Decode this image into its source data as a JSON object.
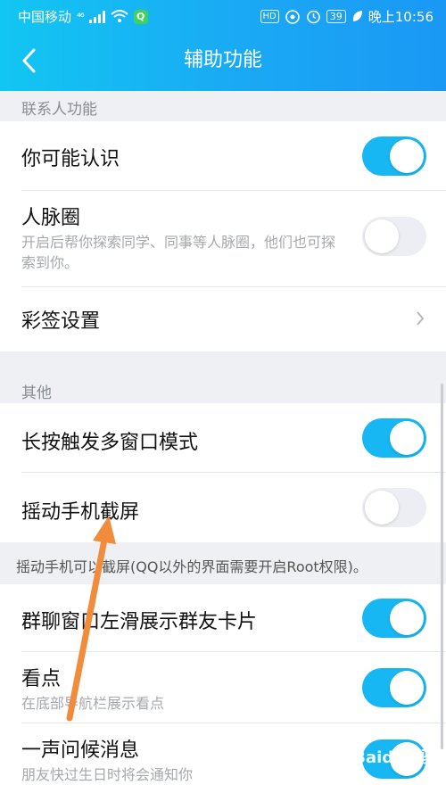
{
  "status_bar": {
    "carrier": "中国移动",
    "signal": "⁴⁶",
    "badge": "Q",
    "hd": "HD",
    "battery": "39",
    "time": "晚上10:56"
  },
  "header": {
    "title": "辅助功能"
  },
  "sections": {
    "contacts": {
      "label": "联系人功能",
      "items": [
        {
          "label": "你可能认识",
          "on": true
        },
        {
          "label": "人脉圈",
          "desc": "开启后帮你探索同学、同事等人脉圈，他们也可探索到你。",
          "on": false
        },
        {
          "label": "彩签设置"
        }
      ]
    },
    "other": {
      "label": "其他",
      "items": [
        {
          "label": "长按触发多窗口模式",
          "on": true
        },
        {
          "label": "摇动手机截屏",
          "on": false
        }
      ],
      "note": "摇动手机可以截屏(QQ以外的界面需要开启Root权限)。",
      "items2": [
        {
          "label": "群聊窗口左滑展示群友卡片",
          "on": true
        },
        {
          "label": "看点",
          "desc": "在底部导航栏展示看点",
          "on": true
        },
        {
          "label": "一声问候消息",
          "desc": "朋友快过生日时将会通知你",
          "on": true
        }
      ]
    }
  },
  "watermark": "Baidu经验",
  "colors": {
    "accent": "#16b7f2",
    "header_start": "#12c6f2",
    "header_end": "#1a98f4",
    "arrow": "#f08c3c"
  }
}
